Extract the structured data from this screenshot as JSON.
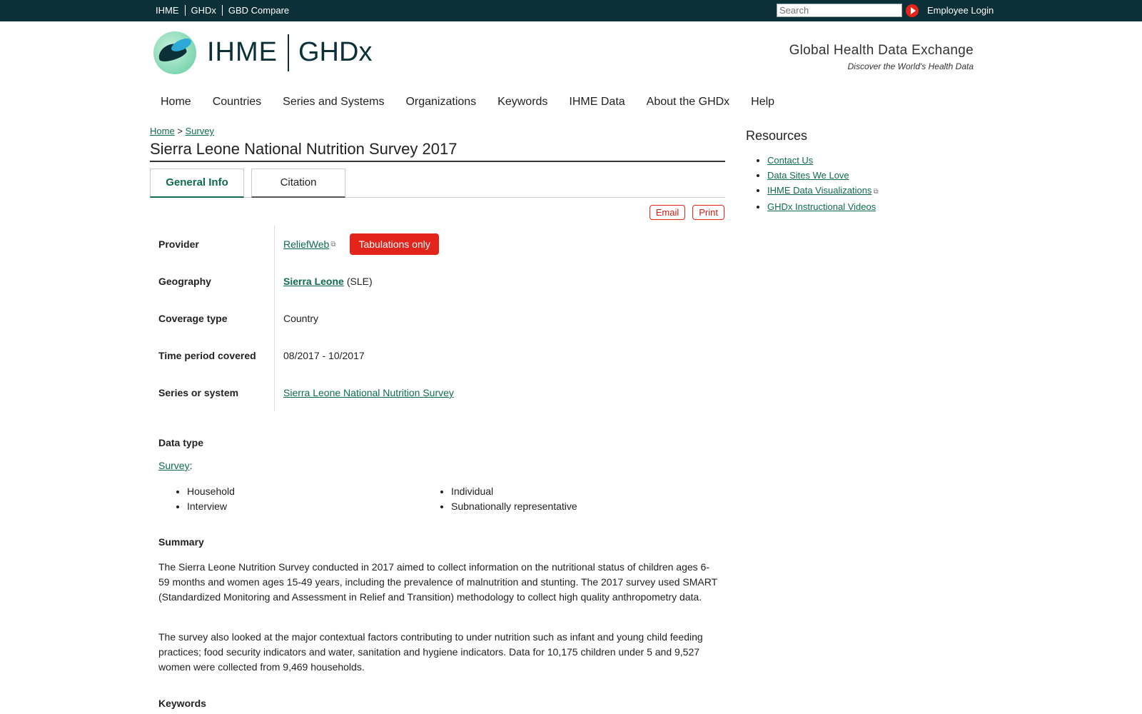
{
  "topbar": {
    "links": [
      "IHME",
      "GHDx",
      "GBD Compare"
    ],
    "search_placeholder": "Search",
    "login": "Employee Login"
  },
  "header": {
    "logo_left": "IHME",
    "logo_right": "GHDx",
    "tagline": "Global Health Data Exchange",
    "subtagline": "Discover the World's Health Data"
  },
  "nav": [
    "Home",
    "Countries",
    "Series and Systems",
    "Organizations",
    "Keywords",
    "IHME Data",
    "About the GHDx",
    "Help"
  ],
  "breadcrumb": {
    "home": "Home",
    "sep": ">",
    "current": "Survey"
  },
  "page_title": "Sierra Leone National Nutrition Survey 2017",
  "tabs": {
    "general": "General Info",
    "citation": "Citation"
  },
  "actions": {
    "email": "Email",
    "print": "Print"
  },
  "info": {
    "provider_label": "Provider",
    "provider_value": "ReliefWeb",
    "provider_badge": "Tabulations only",
    "geography_label": "Geography",
    "geography_value": "Sierra Leone",
    "geography_code": "(SLE)",
    "coverage_label": "Coverage type",
    "coverage_value": "Country",
    "time_label": "Time period covered",
    "time_value": "08/2017 - 10/2017",
    "series_label": "Series or system",
    "series_value": "Sierra Leone National Nutrition Survey"
  },
  "data_type": {
    "heading": "Data type",
    "link": "Survey",
    "colon": ":",
    "col1": [
      "Household",
      "Interview"
    ],
    "col2": [
      "Individual",
      "Subnationally representative"
    ]
  },
  "summary": {
    "heading": "Summary",
    "p1": "The Sierra Leone Nutrition Survey conducted in 2017 aimed to collect information on the nutritional status of children ages 6-59 months and women ages 15-49 years, including the prevalence of malnutrition and stunting. The 2017 survey used SMART (Standardized Monitoring and Assessment in Relief and Transition) methodology to collect high quality anthropometry data.",
    "p2": "The survey also looked at the major contextual factors contributing to under nutrition such as infant and young child feeding practices; food security indicators and water, sanitation and hygiene indicators. Data for 10,175 children under 5 and 9,527 women were collected from 9,469 households."
  },
  "keywords_heading": "Keywords",
  "resources": {
    "title": "Resources",
    "items": [
      "Contact Us",
      "Data Sites We Love",
      "IHME Data Visualizations",
      "GHDx Instructional Videos"
    ]
  }
}
